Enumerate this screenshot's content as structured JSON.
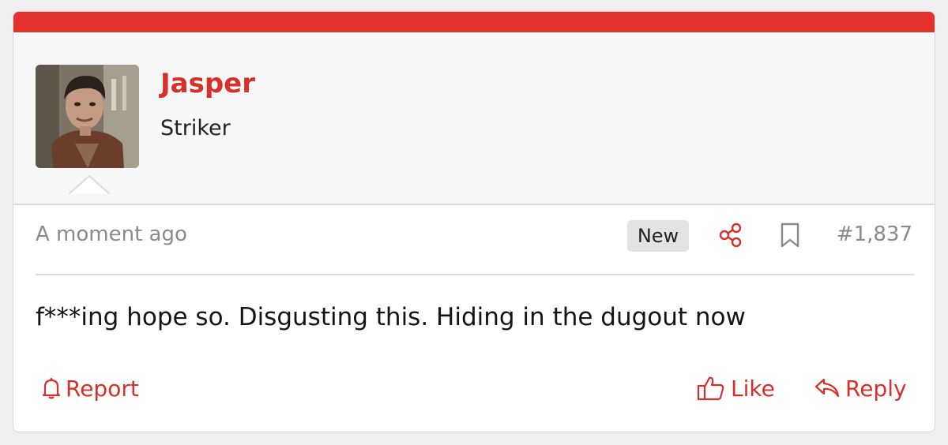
{
  "colors": {
    "accent": "#d7302a",
    "top_bar": "#e3322b",
    "muted_text": "#8a8a8a"
  },
  "user": {
    "name": "Jasper",
    "title": "Striker"
  },
  "post": {
    "timestamp": "A moment ago",
    "badge": "New",
    "number": "#1,837",
    "message": "f***ing hope so. Disgusting this. Hiding in the dugout now"
  },
  "actions": {
    "report_label": "Report",
    "like_label": "Like",
    "reply_label": "Reply"
  },
  "icons": {
    "share": "share-icon",
    "bookmark": "bookmark-icon",
    "report": "bell-icon",
    "like": "thumbs-up-icon",
    "reply": "reply-arrow-icon"
  }
}
